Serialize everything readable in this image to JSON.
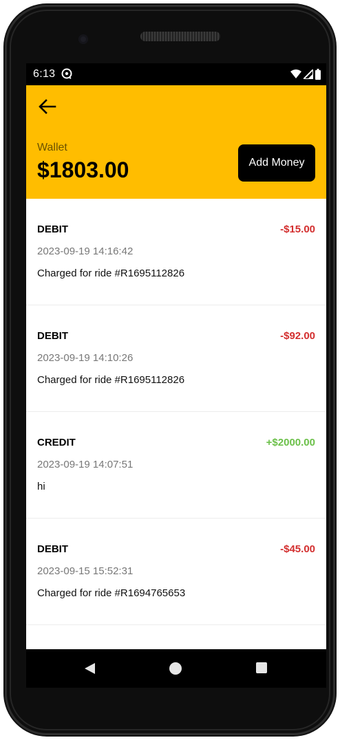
{
  "status_bar": {
    "time": "6:13",
    "icons": [
      "sync-icon",
      "wifi-icon",
      "signal-icon",
      "battery-icon"
    ]
  },
  "header": {
    "back_icon": "arrow-left-icon",
    "wallet_label": "Wallet",
    "balance": "$1803.00",
    "add_money_label": "Add Money",
    "background_color": "#FFBD00"
  },
  "transactions": [
    {
      "type": "DEBIT",
      "amount": "-$15.00",
      "date": "2023-09-19 14:16:42",
      "description": "Charged for ride #R1695112826"
    },
    {
      "type": "DEBIT",
      "amount": "-$92.00",
      "date": "2023-09-19 14:10:26",
      "description": "Charged for ride #R1695112826"
    },
    {
      "type": "CREDIT",
      "amount": "+$2000.00",
      "date": "2023-09-19 14:07:51",
      "description": "hi"
    },
    {
      "type": "DEBIT",
      "amount": "-$45.00",
      "date": "2023-09-15 15:52:31",
      "description": "Charged for ride #R1694765653"
    }
  ],
  "colors": {
    "debit": "#d32f2f",
    "credit": "#6cc04a"
  },
  "nav_bar": {
    "icons": [
      "back-triangle-icon",
      "home-circle-icon",
      "recents-square-icon"
    ]
  }
}
